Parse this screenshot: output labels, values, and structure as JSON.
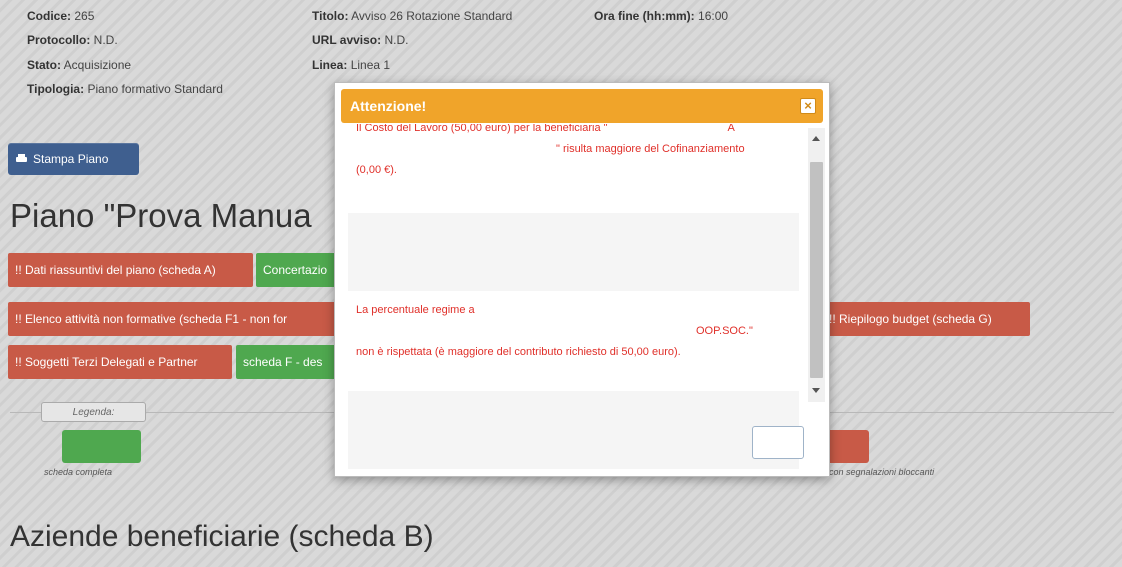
{
  "header_info": {
    "codice_label": "Codice:",
    "codice_value": "265",
    "protocollo_label": "Protocollo:",
    "protocollo_value": "N.D.",
    "stato_label": "Stato:",
    "stato_value": "Acquisizione",
    "tipologia_label": "Tipologia:",
    "tipologia_value": "Piano formativo Standard",
    "titolo_label": "Titolo:",
    "titolo_value": "Avviso 26 Rotazione Standard",
    "url_label": "URL avviso:",
    "url_value": "N.D.",
    "linea_label": "Linea:",
    "linea_value": "Linea 1",
    "ora_fine_label": "Ora fine (hh:mm):",
    "ora_fine_value": "16:00"
  },
  "print_button": {
    "label": "Stampa Piano",
    "icon": "printer-icon"
  },
  "piano_title": "Piano \"Prova Manua",
  "tags": {
    "dati": "!! Dati riassuntivi del piano (scheda A)",
    "concertazione": "Concertazio",
    "elenco": "!! Elenco attività non formative (scheda F1 - non for",
    "riepilogo": "!! Riepilogo budget (scheda G)",
    "soggetti": "!! Soggetti Terzi Delegati e Partner",
    "schedaF": "scheda F - des"
  },
  "legend": {
    "title": "Legenda:",
    "complete": "scheda completa",
    "blocking": "con segnalazioni bloccanti",
    "colors": {
      "complete": "#4fa84f",
      "blocking": "#c85a47"
    }
  },
  "aziende_title": "Aziende beneficiarie (scheda B)",
  "modal": {
    "title": "Attenzione!",
    "close_symbol": "×",
    "msg1_start": "Il Costo del Lavoro (50,00 euro) per la beneficiaria \"",
    "msg1_a": "A",
    "msg1_end": "\" risulta maggiore del Cofinanziamento",
    "msg1_last": "(0,00 €).",
    "msg2_start": "La percentuale regime a",
    "msg2_oop": "OOP.SOC.\"",
    "msg2_last": "non è rispettata (è maggiore del contributo richiesto di 50,00 euro).",
    "header_color": "#f0a42a",
    "error_color": "#e0302a"
  }
}
